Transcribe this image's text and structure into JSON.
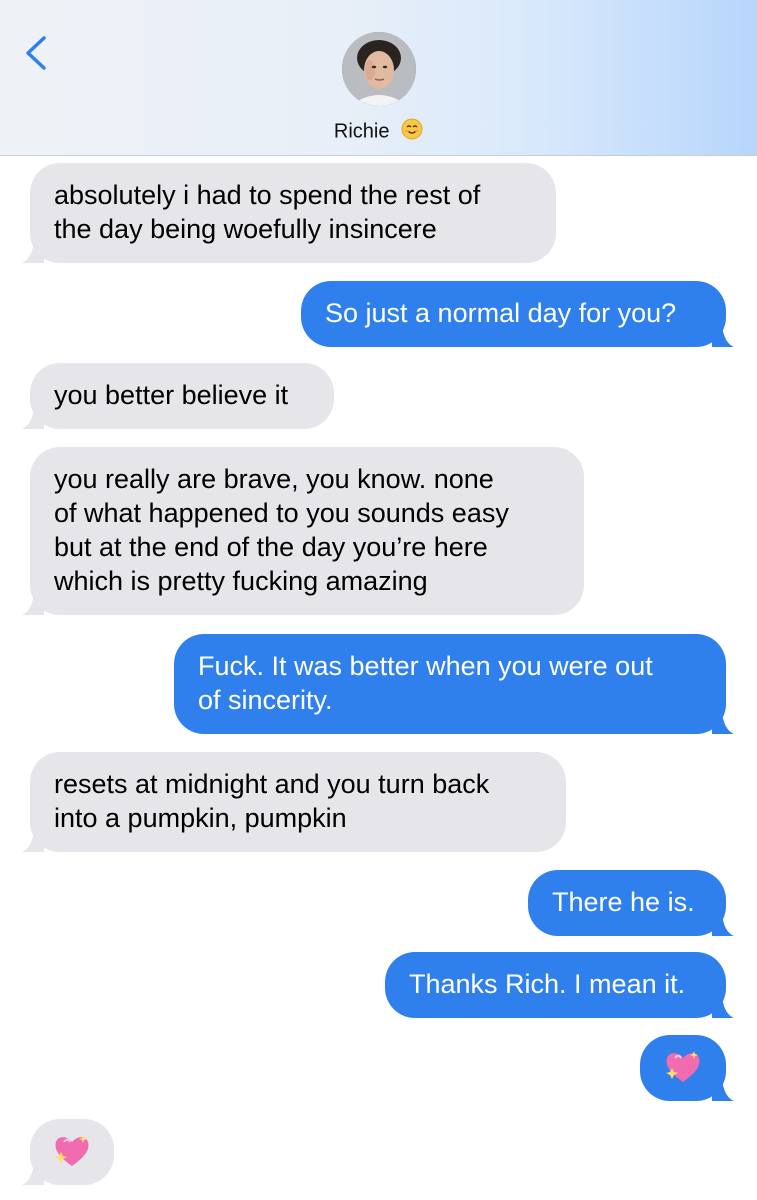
{
  "header": {
    "back_label": "<",
    "contact_name": "Richie",
    "contact_emoji": "smiling-face-icon"
  },
  "messages": [
    {
      "direction": "incoming",
      "text_lines": [
        "absolutely i had to spend the rest of",
        "the day being woefully insincere"
      ]
    },
    {
      "direction": "outgoing",
      "text_lines": [
        "So just a normal day for you?"
      ]
    },
    {
      "direction": "incoming",
      "text_lines": [
        "you better believe it"
      ]
    },
    {
      "direction": "incoming",
      "text_lines": [
        "you really are brave, you know. none",
        "of what happened to you sounds easy",
        "but at the end of the day you’re here",
        "which is pretty fucking amazing"
      ]
    },
    {
      "direction": "outgoing",
      "text_lines": [
        "Fuck. It was better when you were out",
        "of sincerity."
      ]
    },
    {
      "direction": "incoming",
      "text_lines": [
        "resets at midnight and you turn back",
        "into a pumpkin, pumpkin"
      ]
    },
    {
      "direction": "outgoing",
      "text_lines": [
        "There he is."
      ]
    },
    {
      "direction": "outgoing",
      "text_lines": [
        "Thanks Rich. I mean it."
      ]
    },
    {
      "direction": "outgoing",
      "emoji": "sparkling-heart-icon"
    },
    {
      "direction": "incoming",
      "emoji": "sparkling-heart-icon"
    }
  ],
  "colors": {
    "incoming_bubble": "#e5e5ea",
    "outgoing_bubble": "#2f80ed",
    "back_accent": "#2f80ed"
  }
}
